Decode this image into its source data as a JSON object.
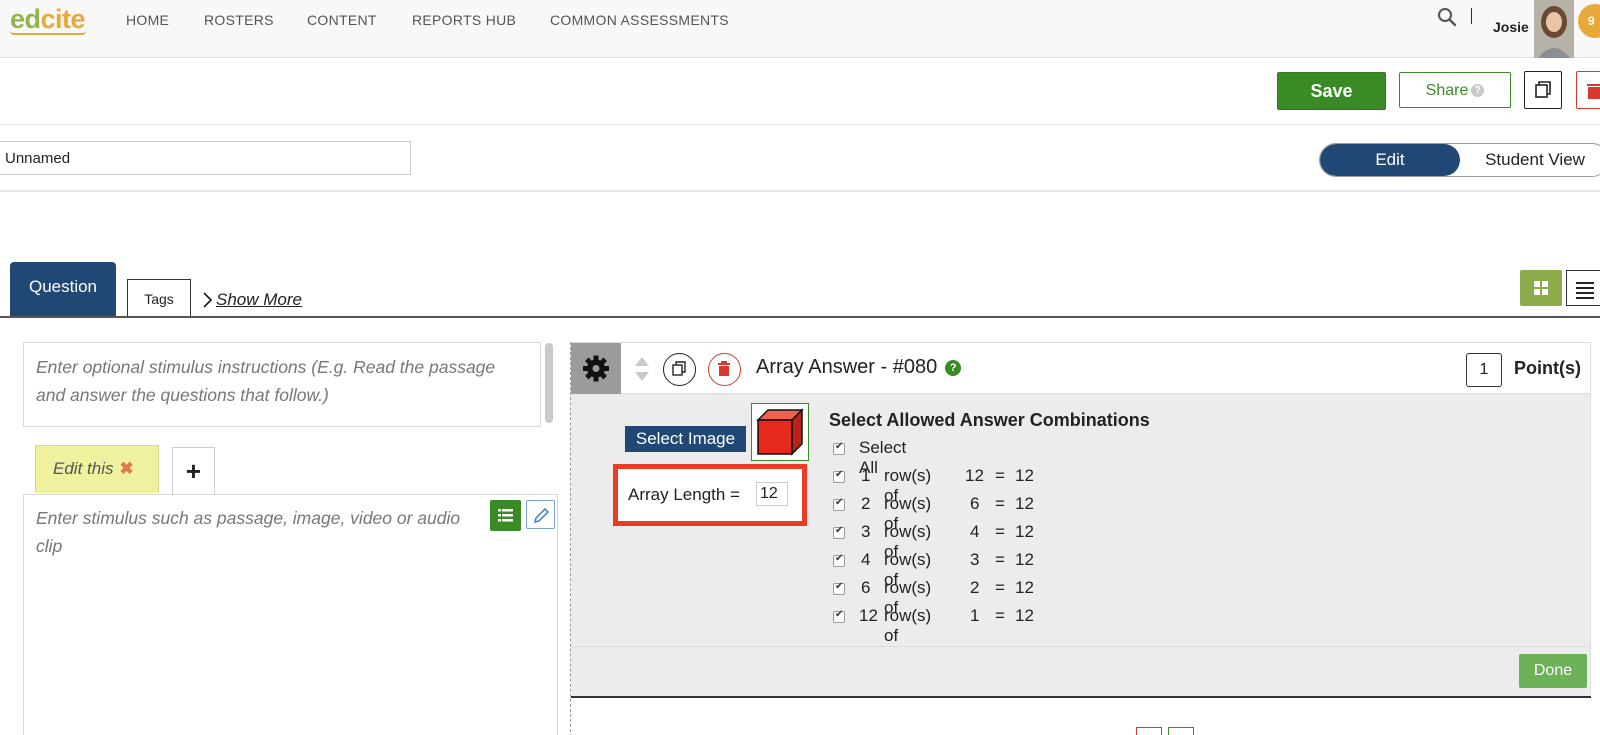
{
  "brand": {
    "logo_part1": "ed",
    "logo_part2": "cite"
  },
  "nav": {
    "items": [
      "HOME",
      "ROSTERS",
      "CONTENT",
      "REPORTS HUB",
      "COMMON ASSESSMENTS"
    ],
    "user_name": "Josie",
    "badge_count": "9"
  },
  "actions": {
    "save_label": "Save",
    "share_label": "Share",
    "share_help": "?"
  },
  "assessment": {
    "name_value": "Unnamed"
  },
  "view_toggle": {
    "edit_label": "Edit",
    "student_label": "Student View",
    "active": "Edit"
  },
  "tabs": {
    "question_label": "Question",
    "tags_label": "Tags",
    "show_more_label": "Show More"
  },
  "stimulus": {
    "instructions_placeholder": "Enter optional stimulus instructions (E.g. Read the passage and answer the questions that follow.)",
    "tab_label": "Edit this",
    "tab_close": "✖",
    "add_tab": "+",
    "body_placeholder": "Enter stimulus such as passage, image, video or audio clip"
  },
  "question": {
    "title": "Array Answer - #080",
    "help": "?",
    "points_value": "1",
    "points_label": "Point(s)",
    "select_image_label": "Select Image",
    "array_length_label": "Array Length =",
    "array_length_value": "12",
    "combos_title": "Select Allowed Answer Combinations",
    "select_all_label": "Select All",
    "combos": [
      {
        "rows": "1",
        "mid": "row(s) of",
        "cols": "12",
        "eq": "=",
        "total": "12"
      },
      {
        "rows": "2",
        "mid": "row(s) of",
        "cols": "6",
        "eq": "=",
        "total": "12"
      },
      {
        "rows": "3",
        "mid": "row(s) of",
        "cols": "4",
        "eq": "=",
        "total": "12"
      },
      {
        "rows": "4",
        "mid": "row(s) of",
        "cols": "3",
        "eq": "=",
        "total": "12"
      },
      {
        "rows": "6",
        "mid": "row(s) of",
        "cols": "2",
        "eq": "=",
        "total": "12"
      },
      {
        "rows": "12",
        "mid": "row(s) of",
        "cols": "1",
        "eq": "=",
        "total": "12"
      }
    ],
    "done_label": "Done"
  },
  "icons": {
    "search": "search-icon",
    "copy": "copy-icon",
    "trash": "trash-icon",
    "gear": "gear-icon",
    "chevron": "chevron-right-icon",
    "grid": "grid-icon",
    "list": "list-icon",
    "pencil": "pencil-icon",
    "move": "move-arrows-icon",
    "cube": "cube-image"
  },
  "colors": {
    "primary_navy": "#214774",
    "save_green": "#3a8b26",
    "delete_red": "#d63a2f",
    "highlight_red": "#ea3b24",
    "tab_yellow": "#eef29f",
    "done_green": "#6db159",
    "grid_olive": "#8cab4a"
  }
}
